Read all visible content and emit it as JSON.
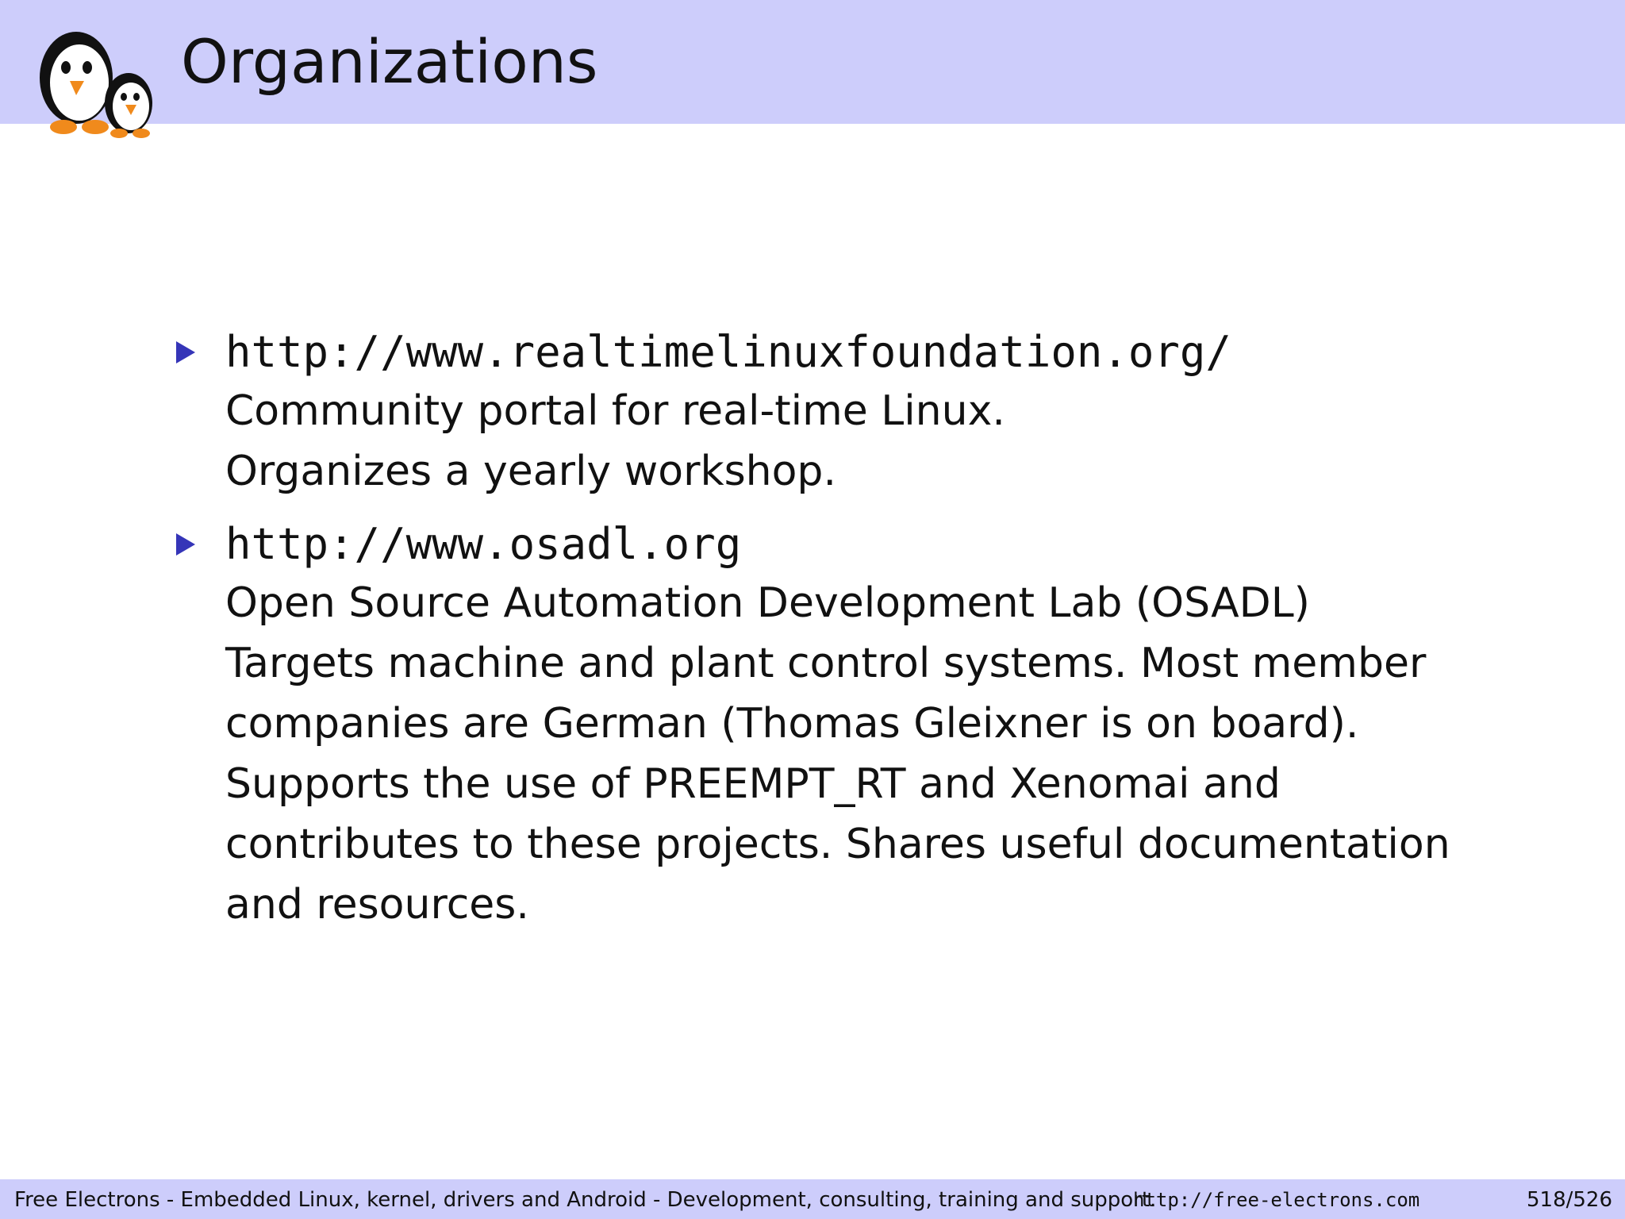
{
  "header": {
    "title": "Organizations"
  },
  "items": [
    {
      "url": "http://www.realtimelinuxfoundation.org/",
      "lines": [
        "Community portal for real-time Linux.",
        "Organizes a yearly workshop."
      ]
    },
    {
      "url": "http://www.osadl.org",
      "lines": [
        "Open Source Automation Development Lab (OSADL)",
        "Targets machine and plant control systems.  Most member",
        "companies are German (Thomas Gleixner is on board).",
        "Supports the use of PREEMPT_RT and Xenomai and",
        "contributes to these projects.  Shares useful documentation",
        "and resources."
      ]
    }
  ],
  "footer": {
    "text": "Free Electrons - Embedded Linux, kernel, drivers and Android - Development, consulting, training and support.",
    "url": "http://free-electrons.com",
    "page": "518/526"
  },
  "colors": {
    "header_bg": "#cdcdfb",
    "bullet": "#3535b8"
  },
  "icons": {
    "logo": "penguins-logo-icon",
    "bullet": "triangle-bullet-icon"
  }
}
